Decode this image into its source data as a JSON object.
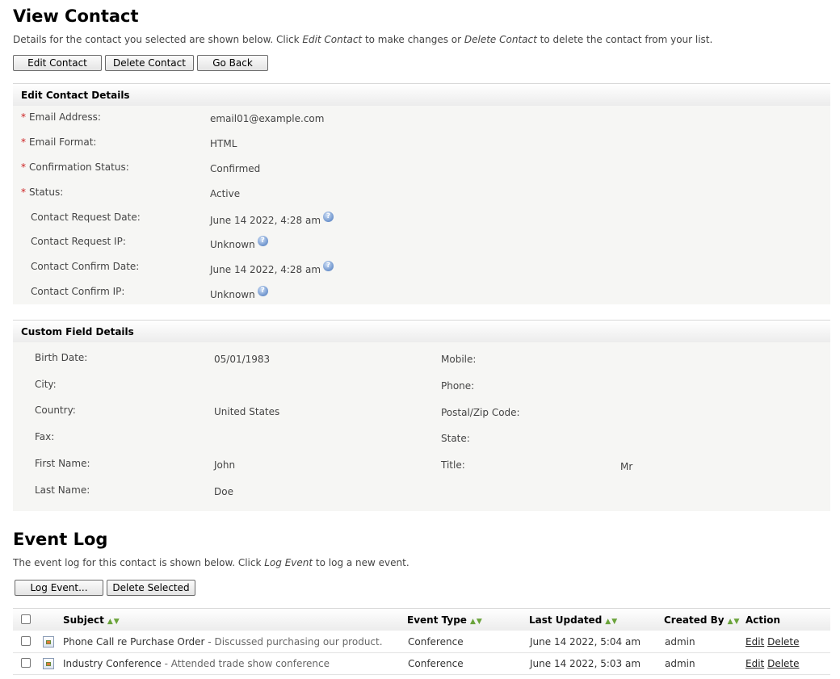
{
  "title": "View Contact",
  "intro": {
    "before": "Details for the contact you selected are shown below. Click ",
    "edit_em": "Edit Contact",
    "middle": " to make changes or ",
    "delete_em": "Delete Contact",
    "after": " to delete the contact from your list."
  },
  "buttons": {
    "edit": "Edit Contact",
    "delete": "Delete Contact",
    "back": "Go Back"
  },
  "contact_details": {
    "heading": "Edit Contact Details",
    "required_mark": "*",
    "email_label": "Email Address:",
    "email_value": "email01@example.com",
    "format_label": "Email Format:",
    "format_value": "HTML",
    "confirmation_label": "Confirmation Status:",
    "confirmation_value": "Confirmed",
    "status_label": "Status:",
    "status_value": "Active",
    "request_date_label": "Contact Request Date:",
    "request_date_value": "June 14 2022, 4:28 am",
    "request_ip_label": "Contact Request IP:",
    "request_ip_value": "Unknown",
    "confirm_date_label": "Contact Confirm Date:",
    "confirm_date_value": "June 14 2022, 4:28 am",
    "confirm_ip_label": "Contact Confirm IP:",
    "confirm_ip_value": "Unknown",
    "help_glyph": "?"
  },
  "custom_fields": {
    "heading": "Custom Field Details",
    "birth_label": "Birth Date:",
    "birth_value": "05/01/1983",
    "city_label": "City:",
    "city_value": "",
    "country_label": "Country:",
    "country_value": "United States",
    "fax_label": "Fax:",
    "fax_value": "",
    "first_label": "First Name:",
    "first_value": "John",
    "last_label": "Last Name:",
    "last_value": "Doe",
    "mobile_label": "Mobile:",
    "mobile_value": "",
    "phone_label": "Phone:",
    "phone_value": "",
    "postal_label": "Postal/Zip Code:",
    "postal_value": "",
    "state_label": "State:",
    "state_value": "",
    "title_label": "Title:",
    "title_value": "Mr"
  },
  "event_log": {
    "heading": "Event Log",
    "intro_before": "The event log for this contact is shown below. Click ",
    "intro_em": "Log Event",
    "intro_after": " to log a new event.",
    "log_button": "Log Event...",
    "delete_selected_button": "Delete Selected",
    "columns": {
      "subject": "Subject",
      "type": "Event Type",
      "updated": "Last Updated",
      "created": "Created By",
      "action": "Action"
    },
    "sort_glyphs": "▲▼",
    "rows": [
      {
        "subject": "Phone Call re Purchase Order",
        "sep": " - ",
        "description": "Discussed purchasing our product.",
        "type": "Conference",
        "updated": "June 14 2022, 5:04 am",
        "created": "admin",
        "edit": "Edit",
        "delete": "Delete"
      },
      {
        "subject": "Industry Conference",
        "sep": " - ",
        "description": "Attended trade show conference",
        "type": "Conference",
        "updated": "June 14 2022, 5:03 am",
        "created": "admin",
        "edit": "Edit",
        "delete": "Delete"
      }
    ]
  }
}
